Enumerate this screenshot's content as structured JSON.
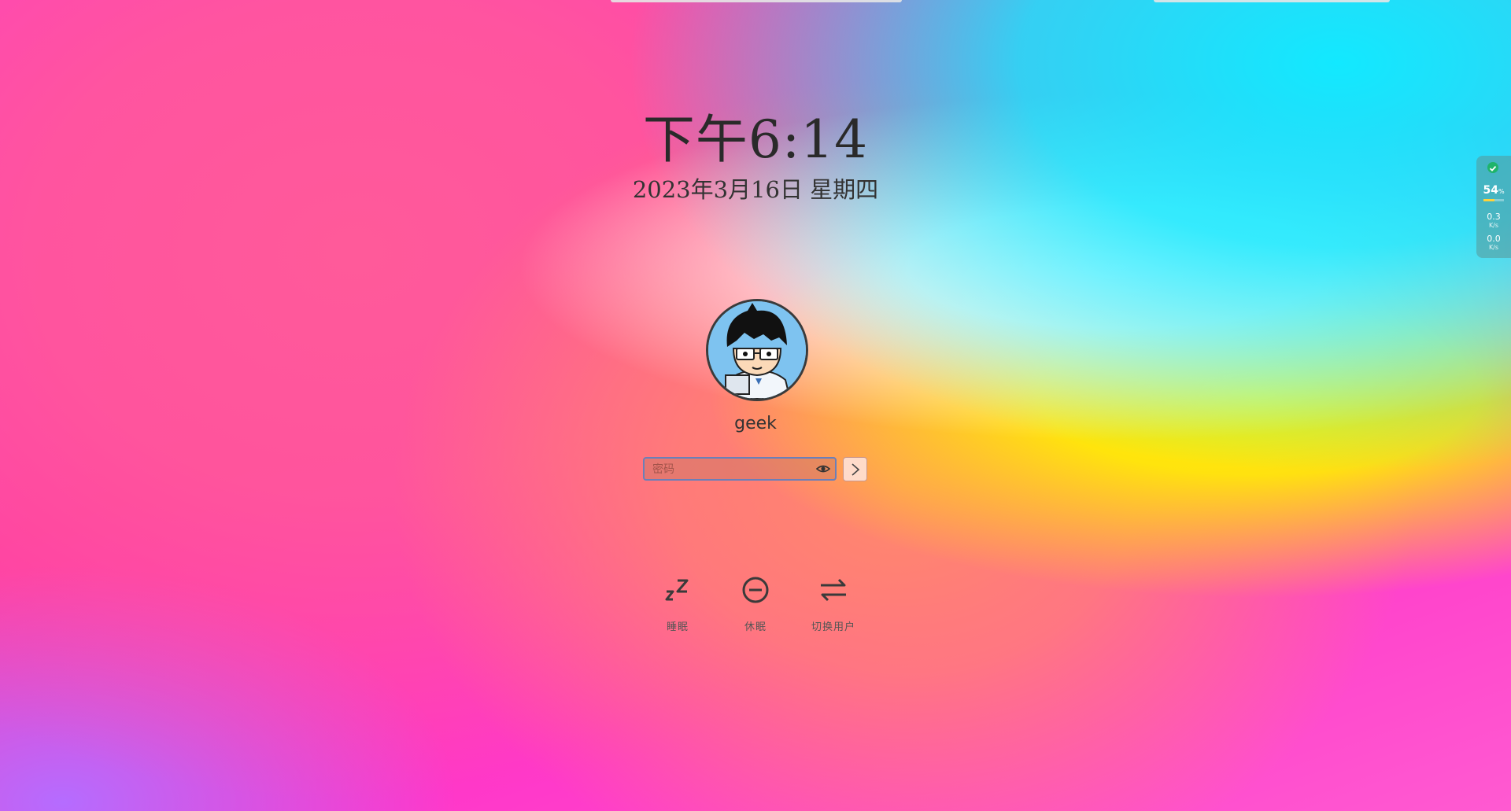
{
  "lockscreen": {
    "time": "下午6:14",
    "date": "2023年3月16日 星期四",
    "username": "geek",
    "password_placeholder": "密码"
  },
  "actions": [
    {
      "label": "睡眠",
      "icon": "sleep-icon"
    },
    {
      "label": "休眠",
      "icon": "hibernate-icon"
    },
    {
      "label": "切换用户",
      "icon": "switch-user-icon"
    }
  ],
  "system_widget": {
    "status_icon": "check-icon",
    "cpu_percent": "54",
    "cpu_unit": "%",
    "cpu_fraction": 0.54,
    "upload": "0.3",
    "download": "0.0",
    "speed_unit": "K/s"
  },
  "colors": {
    "text": "#2a2a2a",
    "input_border": "#6c7fb8",
    "status_green": "#1fb46b"
  }
}
